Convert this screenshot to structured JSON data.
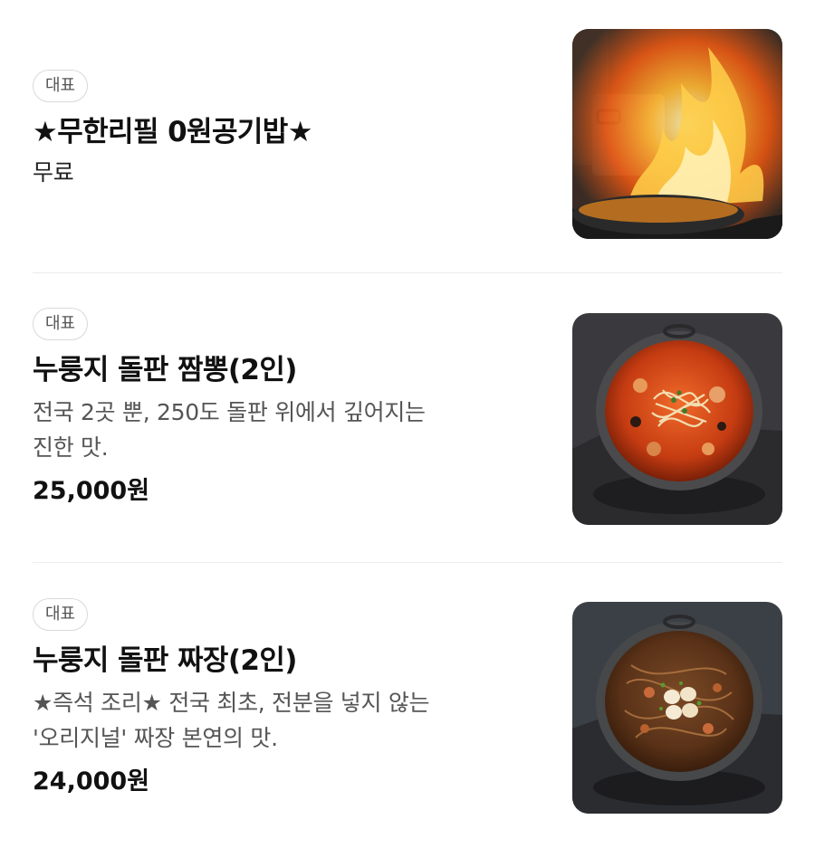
{
  "menu": {
    "items": [
      {
        "badge": "대표",
        "name": "★무한리필 0원공기밥★",
        "description": "무료",
        "price": "",
        "image": "flaming-wok-photo"
      },
      {
        "badge": "대표",
        "name": "누룽지 돌판 짬뽕(2인)",
        "description_line1": "전국 2곳 뿐, 250도 돌판 위에서 깊어지는",
        "description_line2": "진한 맛.",
        "price": "25,000원",
        "image": "stone-plate-jjamppong-photo"
      },
      {
        "badge": "대표",
        "name": "누룽지 돌판 짜장(2인)",
        "description_line1": "★즉석 조리★ 전국 최초, 전분을 넣지 않는",
        "description_line2": "'오리지널' 짜장 본연의 맛.",
        "price": "24,000원",
        "image": "stone-plate-jjajang-photo"
      }
    ]
  },
  "colors": {
    "badge_border": "#d9d9d9",
    "divider": "#ececec",
    "text_primary": "#111111",
    "text_secondary": "#555555"
  }
}
